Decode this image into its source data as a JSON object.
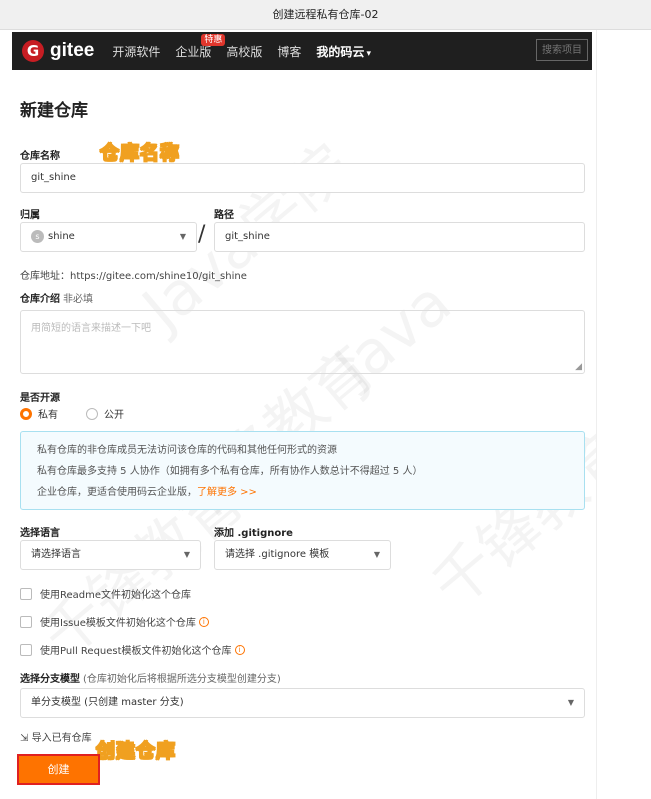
{
  "window": {
    "title": "创建远程私有仓库-02"
  },
  "navbar": {
    "logo_text": "gitee",
    "items": [
      {
        "label": "开源软件"
      },
      {
        "label": "企业版",
        "badge": "特惠"
      },
      {
        "label": "高校版"
      },
      {
        "label": "博客"
      },
      {
        "label": "我的码云"
      }
    ],
    "search_placeholder": "搜索项目"
  },
  "page": {
    "title": "新建仓库"
  },
  "form": {
    "repo_name_label": "仓库名称",
    "repo_name_value": "git_shine",
    "owner_label": "归属",
    "owner_value": "shine",
    "owner_avatar_letter": "s",
    "path_label": "路径",
    "path_value": "git_shine",
    "slash": "/",
    "repo_url": "仓库地址：https://gitee.com/shine10/git_shine",
    "intro_label": "仓库介绍",
    "intro_hint": "非必填",
    "intro_placeholder": "用简短的语言来描述一下吧",
    "visibility_label": "是否开源",
    "visibility_options": [
      "私有",
      "公开"
    ],
    "visibility_selected": "私有",
    "info_lines": [
      "私有仓库的非仓库成员无法访问该仓库的代码和其他任何形式的资源",
      "私有仓库最多支持 5 人协作（如拥有多个私有仓库，所有协作人数总计不得超过 5 人）",
      "企业仓库，更适合使用码云企业版，"
    ],
    "info_link": "了解更多 >>",
    "language_label": "选择语言",
    "language_value": "请选择语言",
    "gitignore_label": "添加 .gitignore",
    "gitignore_value": "请选择 .gitignore 模板",
    "checkboxes": [
      "使用Readme文件初始化这个仓库",
      "使用Issue模板文件初始化这个仓库",
      "使用Pull Request模板文件初始化这个仓库"
    ],
    "branch_label": "选择分支模型",
    "branch_hint": "(仓库初始化后将根据所选分支模型创建分支)",
    "branch_value": "单分支模型 (只创建 master 分支)",
    "import_link": "导入已有仓库",
    "create_button": "创建"
  },
  "annotations": {
    "repo_name": "仓库名称",
    "create": "创建仓库"
  },
  "watermark": [
    "Java学院",
    "千锋教育",
    "Java",
    "千锋教育",
    "千锋教育"
  ],
  "colors": {
    "accent": "#fe7300",
    "highlight_border": "#e02020",
    "navbar": "#1f1f1f",
    "logo": "#c71d23",
    "annotation": "#f0a020"
  }
}
